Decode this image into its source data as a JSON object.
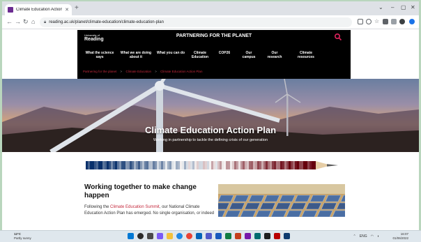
{
  "browser": {
    "tab_title": "Climate Education Action Plan",
    "url": "reading.ac.uk/planet/climate-education/climate-education-plan"
  },
  "site": {
    "logo_small": "University of",
    "logo_big": "Reading",
    "title": "PARTNERING FOR THE PLANET",
    "nav": [
      "What the science says",
      "What we are doing about it",
      "What you can do",
      "Climate Education",
      "COP26",
      "Our campus",
      "Our research",
      "Climate resources"
    ],
    "breadcrumbs": [
      "Partnering for the planet",
      "Climate Education",
      "Climate Education Action Plan"
    ],
    "breadcrumb_sep": ">"
  },
  "hero": {
    "title": "Climate Education Action Plan",
    "subtitle": "Working in partnership to tackle the defining crisis of our generation"
  },
  "content": {
    "heading": "Working together to make change happen",
    "para_pre": "Following the ",
    "para_link": "Climate Education Summit",
    "para_post": ", our National Climate Education Action Plan has emerged. No single organisation, or indeed government department, is able to take this agenda forward alone. Informed by diverse"
  },
  "taskbar": {
    "temp": "12°C",
    "weather": "Partly sunny",
    "lang": "ENG",
    "time": "16:07",
    "date": "01/06/2022"
  },
  "colors": {
    "brand_red": "#c4283c",
    "header_bg": "#000000"
  }
}
